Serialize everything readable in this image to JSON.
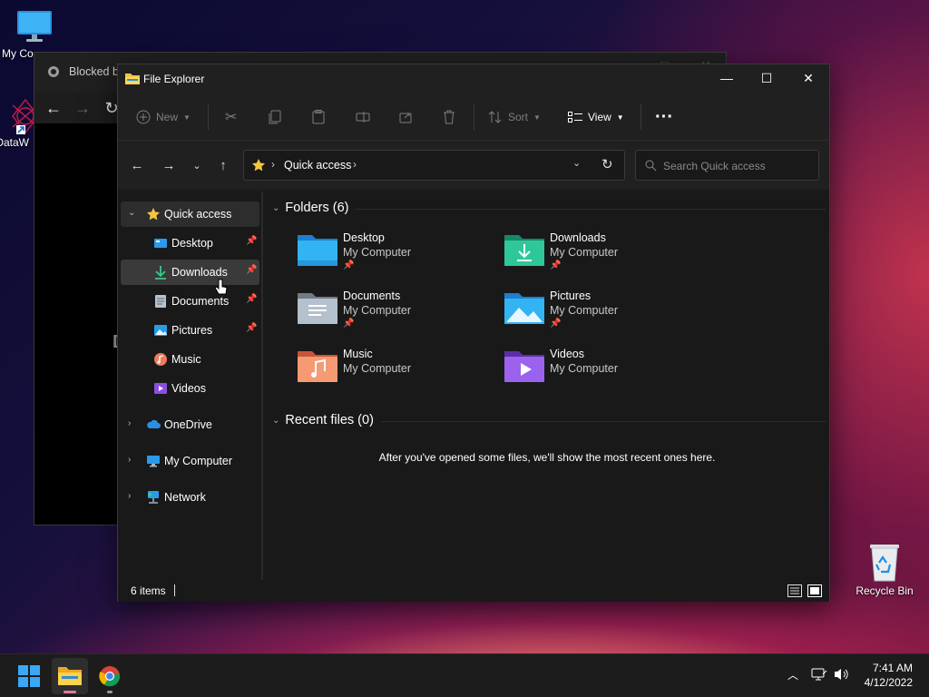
{
  "desktop": {
    "icons": [
      {
        "label": "My Co"
      },
      {
        "label": "DataW"
      },
      {
        "label": "Recycle Bin"
      }
    ]
  },
  "browser": {
    "tab_title": "Blocked b",
    "partial_text": "D"
  },
  "explorer": {
    "title": "File Explorer",
    "commands": {
      "new": "New",
      "sort": "Sort",
      "view": "View"
    },
    "address": {
      "crumb": "Quick access",
      "search_placeholder": "Search Quick access"
    },
    "nav": {
      "quick_access": "Quick access",
      "pinned": [
        {
          "label": "Desktop"
        },
        {
          "label": "Downloads"
        },
        {
          "label": "Documents"
        },
        {
          "label": "Pictures"
        },
        {
          "label": "Music"
        },
        {
          "label": "Videos"
        }
      ],
      "onedrive": "OneDrive",
      "my_computer": "My Computer",
      "network": "Network"
    },
    "folders_header": "Folders (6)",
    "folders": [
      {
        "name": "Desktop",
        "location": "My Computer",
        "pinned": true
      },
      {
        "name": "Downloads",
        "location": "My Computer",
        "pinned": true
      },
      {
        "name": "Documents",
        "location": "My Computer",
        "pinned": true
      },
      {
        "name": "Pictures",
        "location": "My Computer",
        "pinned": true
      },
      {
        "name": "Music",
        "location": "My Computer",
        "pinned": false
      },
      {
        "name": "Videos",
        "location": "My Computer",
        "pinned": false
      }
    ],
    "recent_header": "Recent files (0)",
    "recent_empty": "After you've opened some files, we'll show the most recent ones here.",
    "status": "6 items"
  },
  "taskbar": {
    "time": "7:41 AM",
    "date": "4/12/2022"
  },
  "colors": {
    "accent": "#0078d4",
    "folder_yellow": "#f5c542",
    "selection": "#3a3a3a"
  }
}
